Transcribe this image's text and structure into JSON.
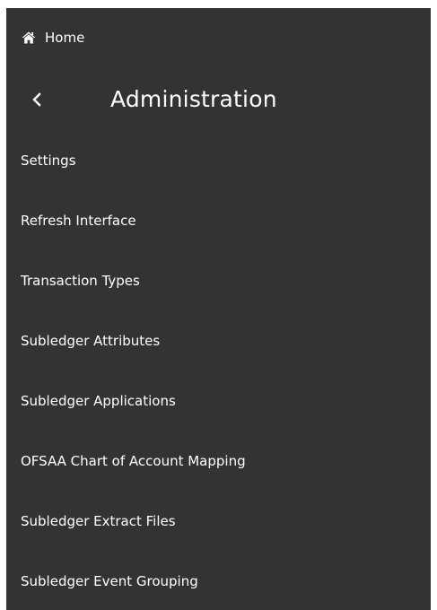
{
  "nav": {
    "home_label": "Home",
    "home_icon": "home-icon",
    "back_icon": "chevron-left-icon",
    "title": "Administration"
  },
  "menu": {
    "items": [
      {
        "label": "Settings"
      },
      {
        "label": "Refresh Interface"
      },
      {
        "label": "Transaction Types"
      },
      {
        "label": "Subledger Attributes"
      },
      {
        "label": "Subledger Applications"
      },
      {
        "label": "OFSAA Chart of Account Mapping"
      },
      {
        "label": "Subledger Extract Files"
      },
      {
        "label": "Subledger Event Grouping"
      }
    ]
  },
  "colors": {
    "panel_background": "#333333",
    "text": "#ffffff",
    "page_background": "#ffffff"
  }
}
